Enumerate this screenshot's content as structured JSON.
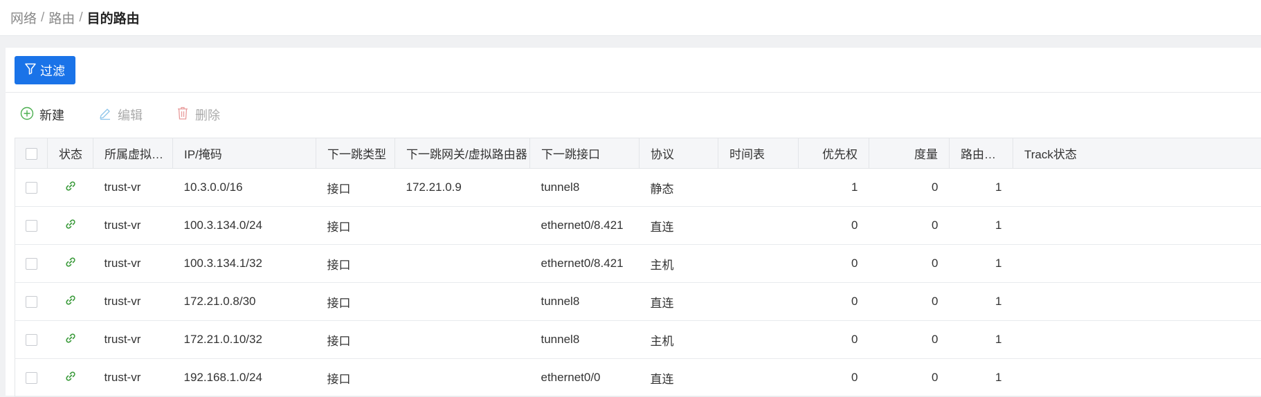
{
  "breadcrumb": {
    "items": [
      "网络",
      "路由"
    ],
    "separator": "/",
    "current": "目的路由"
  },
  "filter": {
    "label": "过滤",
    "icon": "filter-icon"
  },
  "toolbar": {
    "new_label": "新建",
    "new_icon": "plus-circle-icon",
    "edit_label": "编辑",
    "edit_icon": "edit-icon",
    "delete_label": "删除",
    "delete_icon": "trash-icon"
  },
  "colors": {
    "accent": "#1a73e8",
    "status_green": "#3a9a3a"
  },
  "table": {
    "columns": [
      "状态",
      "所属虚拟…",
      "IP/掩码",
      "下一跳类型",
      "下一跳网关/虚拟路由器",
      "下一跳接口",
      "协议",
      "时间表",
      "优先权",
      "度量",
      "路由…",
      "Track状态"
    ],
    "rows": [
      {
        "status": "link-icon",
        "vr": "trust-vr",
        "ip": "10.3.0.0/16",
        "nh_type": "接口",
        "gateway": "172.21.0.9",
        "iface": "tunnel8",
        "protocol": "静态",
        "schedule": "",
        "priority": "1",
        "metric": "0",
        "route": "1",
        "track": ""
      },
      {
        "status": "link-icon",
        "vr": "trust-vr",
        "ip": "100.3.134.0/24",
        "nh_type": "接口",
        "gateway": "",
        "iface": "ethernet0/8.421",
        "protocol": "直连",
        "schedule": "",
        "priority": "0",
        "metric": "0",
        "route": "1",
        "track": ""
      },
      {
        "status": "link-icon",
        "vr": "trust-vr",
        "ip": "100.3.134.1/32",
        "nh_type": "接口",
        "gateway": "",
        "iface": "ethernet0/8.421",
        "protocol": "主机",
        "schedule": "",
        "priority": "0",
        "metric": "0",
        "route": "1",
        "track": ""
      },
      {
        "status": "link-icon",
        "vr": "trust-vr",
        "ip": "172.21.0.8/30",
        "nh_type": "接口",
        "gateway": "",
        "iface": "tunnel8",
        "protocol": "直连",
        "schedule": "",
        "priority": "0",
        "metric": "0",
        "route": "1",
        "track": ""
      },
      {
        "status": "link-icon",
        "vr": "trust-vr",
        "ip": "172.21.0.10/32",
        "nh_type": "接口",
        "gateway": "",
        "iface": "tunnel8",
        "protocol": "主机",
        "schedule": "",
        "priority": "0",
        "metric": "0",
        "route": "1",
        "track": ""
      },
      {
        "status": "link-icon",
        "vr": "trust-vr",
        "ip": "192.168.1.0/24",
        "nh_type": "接口",
        "gateway": "",
        "iface": "ethernet0/0",
        "protocol": "直连",
        "schedule": "",
        "priority": "0",
        "metric": "0",
        "route": "1",
        "track": ""
      }
    ]
  }
}
